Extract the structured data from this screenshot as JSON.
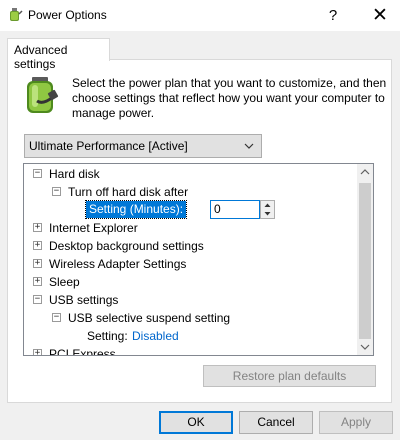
{
  "window": {
    "title": "Power Options",
    "help_glyph": "?",
    "close_glyph": "✕"
  },
  "tabs": [
    {
      "label": "Advanced settings",
      "selected": true
    }
  ],
  "description": "Select the power plan that you want to customize, and then choose settings that reflect how you want your computer to manage power.",
  "plan_selector": {
    "value": "Ultimate Performance [Active]"
  },
  "tree": {
    "items": [
      {
        "label": "Hard disk",
        "expanded": true,
        "level": 0
      },
      {
        "label": "Turn off hard disk after",
        "expanded": true,
        "level": 1
      },
      {
        "label": "Setting (Minutes):",
        "value": "0",
        "level": 2
      },
      {
        "label": "Internet Explorer",
        "expanded": false,
        "level": 0
      },
      {
        "label": "Desktop background settings",
        "expanded": false,
        "level": 0
      },
      {
        "label": "Wireless Adapter Settings",
        "expanded": false,
        "level": 0
      },
      {
        "label": "Sleep",
        "expanded": false,
        "level": 0
      },
      {
        "label": "USB settings",
        "expanded": true,
        "level": 0
      },
      {
        "label": "USB selective suspend setting",
        "expanded": true,
        "level": 1
      },
      {
        "label": "Setting:",
        "value": "Disabled",
        "level": 2
      },
      {
        "label": "PCI Express",
        "expanded": false,
        "level": 0
      }
    ]
  },
  "buttons": {
    "restore": "Restore plan defaults",
    "ok": "OK",
    "cancel": "Cancel",
    "apply": "Apply"
  },
  "colors": {
    "accent": "#0078d7",
    "link": "#0066cc",
    "disabled_text": "#838383"
  }
}
